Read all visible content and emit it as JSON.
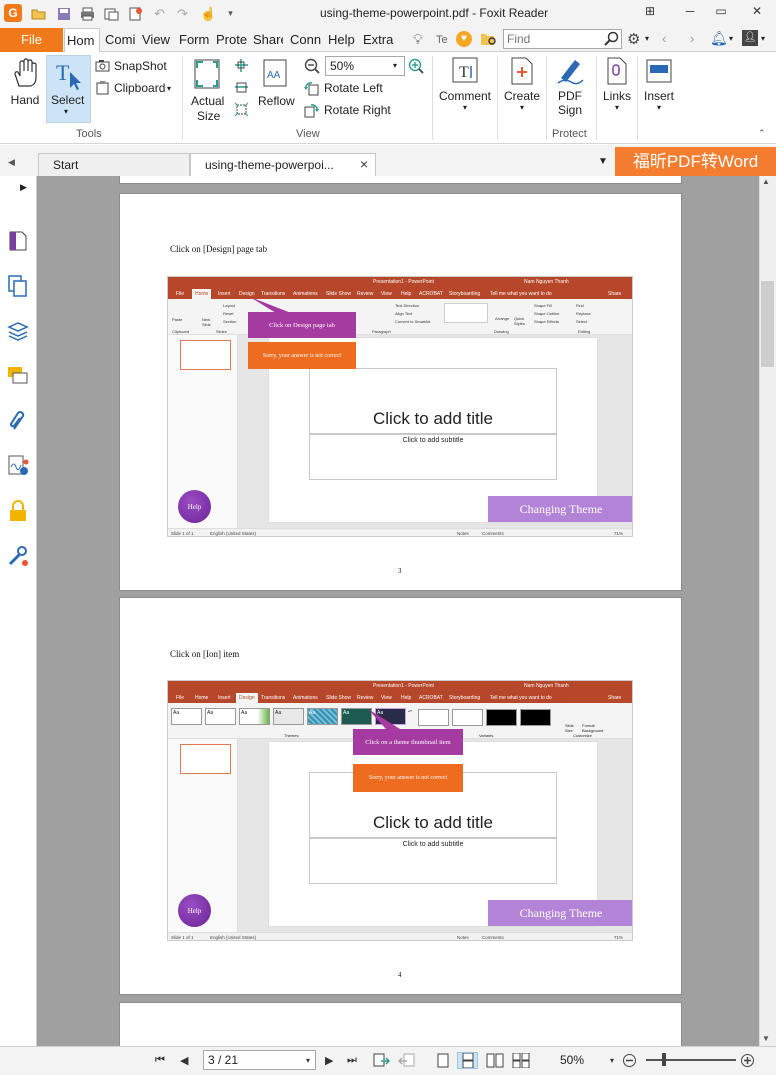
{
  "app": {
    "title": "using-theme-powerpoint.pdf - Foxit Reader",
    "logo": "foxit-logo",
    "accent": "#f07a1a"
  },
  "menu": {
    "file": "File",
    "tabs": [
      "Hom",
      "Comi",
      "View",
      "Form",
      "Prote",
      "Share",
      "Conn",
      "Help",
      "Extra"
    ],
    "tell_me": "Te",
    "find_placeholder": "Find"
  },
  "ribbon": {
    "hand": "Hand",
    "select": "Select",
    "snapshot": "SnapShot",
    "clipboard": "Clipboard",
    "tools_group": "Tools",
    "actual_size_1": "Actual",
    "actual_size_2": "Size",
    "reflow": "Reflow",
    "zoom_value": "50%",
    "rotate_left": "Rotate Left",
    "rotate_right": "Rotate Right",
    "view_group": "View",
    "comment": "Comment",
    "create": "Create",
    "pdf_sign_1": "PDF",
    "pdf_sign_2": "Sign",
    "protect_group": "Protect",
    "links": "Links",
    "insert": "Insert"
  },
  "doc_tabs": {
    "start": "Start",
    "current": "using-theme-powerpoi...",
    "close": "×",
    "promo": "福昕PDF转Word"
  },
  "pages": [
    {
      "instruction": "Click on [Design] page tab",
      "page_number": "3",
      "callout": "Click on Design page tab",
      "error": "Sorry, your answer is not correct",
      "title_placeholder": "Click to add title",
      "subtitle_placeholder": "Click to add subtitle",
      "theme_label": "Changing Theme",
      "help": "Help",
      "pp_title": "Presentation1 - PowerPoint",
      "pp_user": "Nam Nguyen Thanh",
      "pp_active_tab": "Home",
      "pp_tabs": [
        "File",
        "Home",
        "Insert",
        "Design",
        "Transitions",
        "Animations",
        "Slide Show",
        "Review",
        "View",
        "Help",
        "ACROBAT",
        "Storyboarding"
      ],
      "pp_tell": "Tell me what you want to do",
      "pp_share": "Share",
      "pp_status_left": "Slide 1 of 1",
      "pp_status_lang": "English (United States)",
      "pp_notes": "Notes",
      "pp_comments": "Comments",
      "pp_zoom": "71%"
    },
    {
      "instruction": "Click on [Ion] item",
      "page_number": "4",
      "callout": "Click on a theme thumbnail item",
      "error": "Sorry, your answer is not correct",
      "title_placeholder": "Click to add title",
      "subtitle_placeholder": "Click to add subtitle",
      "theme_label": "Changing Theme",
      "help": "Help",
      "pp_title": "Presentation1 - PowerPoint",
      "pp_user": "Nam Nguyen Thanh",
      "pp_active_tab": "Design",
      "pp_tabs": [
        "File",
        "Home",
        "Insert",
        "Design",
        "Transitions",
        "Animations",
        "Slide Show",
        "Review",
        "View",
        "Help",
        "ACROBAT",
        "Storyboarding"
      ],
      "pp_tell": "Tell me what you want to do",
      "pp_share": "Share",
      "pp_status_left": "Slide 1 of 1",
      "pp_status_lang": "English (United States)",
      "pp_notes": "Notes",
      "pp_comments": "Comments",
      "pp_zoom": "71%",
      "themes_group": "Themes",
      "variants_group": "Variants",
      "customize_group": "Customize",
      "slide_size": "Slide Size",
      "format_background": "Format Background"
    }
  ],
  "pp_ribbon_home": {
    "paste": "Paste",
    "new_slide": "New Slide",
    "layout": "Layout",
    "reset": "Reset",
    "section": "Section",
    "clipboard": "Clipboard",
    "slides": "Slides",
    "paragraph": "Paragraph",
    "drawing": "Drawing",
    "editing": "Editing",
    "text_direction": "Text Direction",
    "align_text": "Align Text",
    "convert_smartart": "Convert to SmartArt",
    "arrange": "Arrange",
    "quick_styles": "Quick Styles",
    "shape_fill": "Shape Fill",
    "shape_outline": "Shape Outline",
    "shape_effects": "Shape Effects",
    "find": "Find",
    "replace": "Replace",
    "select": "Select"
  },
  "theme_thumbs": [
    "Aa",
    "Aa",
    "Aa",
    "Aa",
    "Aa",
    "Aa",
    "Aa"
  ],
  "bottom": {
    "page_field": "3 / 21",
    "zoom": "50%"
  }
}
